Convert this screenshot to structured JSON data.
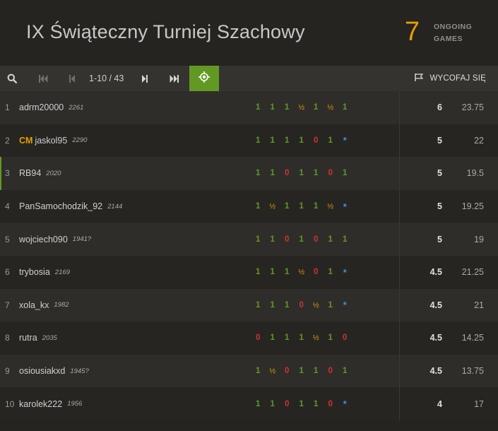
{
  "tournament": {
    "title": "IX Świąteczny Turniej Szachowy",
    "ongoing_count": "7",
    "ongoing_label_1": "ONGOING",
    "ongoing_label_2": "GAMES"
  },
  "toolbar": {
    "search_icon": "search-icon",
    "first_icon": "first-page-icon",
    "prev_icon": "prev-page-icon",
    "page_info": "1-10 / 43",
    "next_icon": "next-page-icon",
    "last_icon": "last-page-icon",
    "focus_icon": "crosshair-icon",
    "withdraw_icon": "flag-icon",
    "withdraw_label": "WYCOFAJ SIĘ"
  },
  "colors": {
    "accent_green": "#629924",
    "title_orange": "#e69f00",
    "loss_red": "#cc3333",
    "ongoing_blue": "#3692e7"
  },
  "standings": [
    {
      "rank": "1",
      "title": "",
      "name": "adrm20000",
      "rating": "2261",
      "results": [
        "1",
        "1",
        "1",
        "½",
        "1",
        "½",
        "1"
      ],
      "points": "6",
      "performance": "23.75"
    },
    {
      "rank": "2",
      "title": "CM",
      "name": "jaskol95",
      "rating": "2290",
      "results": [
        "1",
        "1",
        "1",
        "1",
        "0",
        "1",
        "*"
      ],
      "points": "5",
      "performance": "22"
    },
    {
      "rank": "3",
      "title": "",
      "name": "RB94",
      "rating": "2020",
      "results": [
        "1",
        "1",
        "0",
        "1",
        "1",
        "0",
        "1"
      ],
      "points": "5",
      "performance": "19.5"
    },
    {
      "rank": "4",
      "title": "",
      "name": "PanSamochodzik_92",
      "rating": "2144",
      "results": [
        "1",
        "½",
        "1",
        "1",
        "1",
        "½",
        "*"
      ],
      "points": "5",
      "performance": "19.25"
    },
    {
      "rank": "5",
      "title": "",
      "name": "wojciech090",
      "rating": "1941?",
      "results": [
        "1",
        "1",
        "0",
        "1",
        "0",
        "1",
        "1"
      ],
      "points": "5",
      "performance": "19"
    },
    {
      "rank": "6",
      "title": "",
      "name": "trybosia",
      "rating": "2169",
      "results": [
        "1",
        "1",
        "1",
        "½",
        "0",
        "1",
        "*"
      ],
      "points": "4.5",
      "performance": "21.25"
    },
    {
      "rank": "7",
      "title": "",
      "name": "xola_kx",
      "rating": "1982",
      "results": [
        "1",
        "1",
        "1",
        "0",
        "½",
        "1",
        "*"
      ],
      "points": "4.5",
      "performance": "21"
    },
    {
      "rank": "8",
      "title": "",
      "name": "rutra",
      "rating": "2035",
      "results": [
        "0",
        "1",
        "1",
        "1",
        "½",
        "1",
        "0"
      ],
      "points": "4.5",
      "performance": "14.25"
    },
    {
      "rank": "9",
      "title": "",
      "name": "osiousiakxd",
      "rating": "1945?",
      "results": [
        "1",
        "½",
        "0",
        "1",
        "1",
        "0",
        "1"
      ],
      "points": "4.5",
      "performance": "13.75"
    },
    {
      "rank": "10",
      "title": "",
      "name": "karolek222",
      "rating": "1956",
      "results": [
        "1",
        "1",
        "0",
        "1",
        "1",
        "0",
        "*"
      ],
      "points": "4",
      "performance": "17"
    }
  ]
}
